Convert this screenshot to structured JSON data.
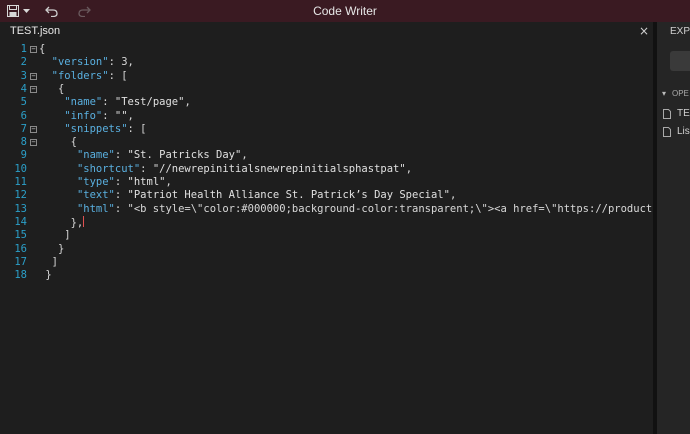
{
  "titlebar": {
    "title": "Code Writer",
    "icons": [
      "save-icon",
      "dropdown-caret-icon",
      "undo-icon",
      "redo-icon"
    ]
  },
  "editor": {
    "tab": {
      "label": "TEST.json",
      "close": "×"
    },
    "lines": [
      {
        "num": "1",
        "fold": "−",
        "text": "{"
      },
      {
        "num": "2",
        "text": "  \"version\": 3,"
      },
      {
        "num": "3",
        "fold": "−",
        "text": "  \"folders\": ["
      },
      {
        "num": "4",
        "fold": "−",
        "text": "   {"
      },
      {
        "num": "5",
        "text": "    \"name\": \"Test/page\","
      },
      {
        "num": "6",
        "text": "    \"info\": \"\","
      },
      {
        "num": "7",
        "fold": "−",
        "text": "    \"snippets\": ["
      },
      {
        "num": "8",
        "fold": "−",
        "text": "     {"
      },
      {
        "num": "9",
        "text": "      \"name\": \"St. Patricks Day\","
      },
      {
        "num": "10",
        "text": "      \"shortcut\": \"//newrepinitialsnewrepinitialsphastpat\","
      },
      {
        "num": "11",
        "text": "      \"type\": \"html\","
      },
      {
        "num": "12",
        "text": "      \"text\": \"Patriot Health Alliance St. Patrick’s Day Special\","
      },
      {
        "num": "13",
        "text": "      \"html\": \"<b style=\\\"color:#000000;background-color:transparent;\\\"><a href=\\\"https://product"
      },
      {
        "num": "14",
        "text": "     },"
      },
      {
        "num": "15",
        "text": "    ]"
      },
      {
        "num": "16",
        "text": "   }"
      },
      {
        "num": "17",
        "text": "  ]"
      },
      {
        "num": "18",
        "text": " }"
      }
    ]
  },
  "sidebar": {
    "header": "EXPL",
    "section_label": "OPE",
    "files": [
      "TES",
      "Lisa"
    ]
  },
  "colors": {
    "titlebar": "#3a1a22",
    "line_numbers": "#2b9fc8",
    "keys": "#5ab0e0"
  }
}
